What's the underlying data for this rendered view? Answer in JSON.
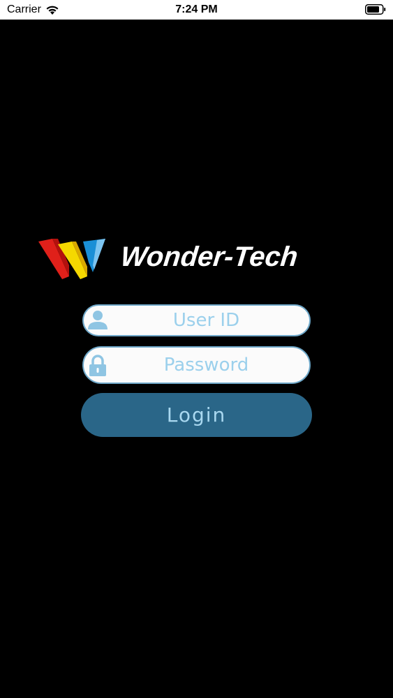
{
  "status_bar": {
    "carrier": "Carrier",
    "time": "7:24 PM",
    "wifi_icon": "wifi-icon",
    "battery_icon": "battery-icon"
  },
  "logo": {
    "text": "Wonder-Tech",
    "mark_colors": [
      "#e0201a",
      "#f5d800",
      "#1a8fd6"
    ]
  },
  "login_form": {
    "user_id_placeholder": "User ID",
    "user_id_value": "",
    "user_icon": "user-icon",
    "password_placeholder": "Password",
    "password_value": "",
    "lock_icon": "lock-icon",
    "login_label": "Login"
  },
  "colors": {
    "background": "#000000",
    "field_border": "#6fa8c9",
    "placeholder": "#9bd0ec",
    "button": "#2a6688",
    "button_text": "#a9d8f0"
  }
}
